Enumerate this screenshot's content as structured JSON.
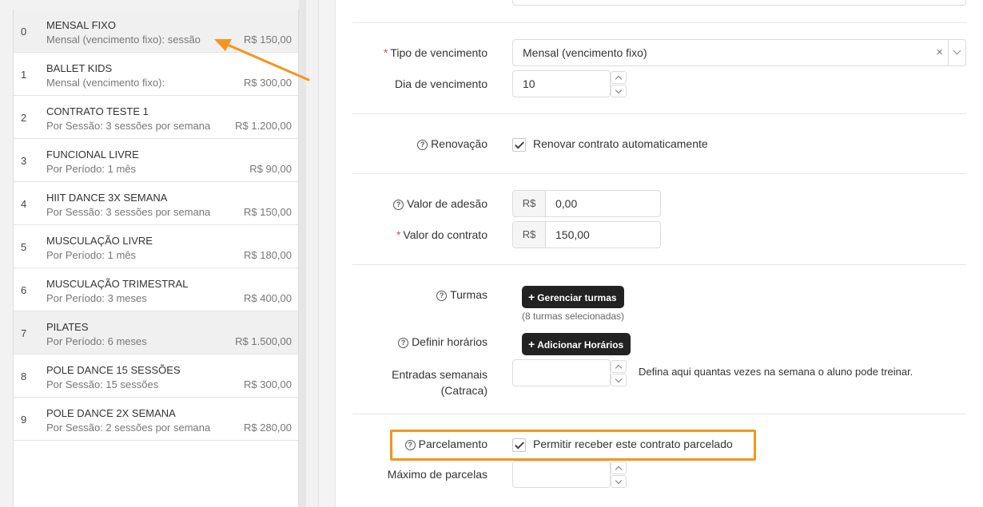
{
  "contracts": [
    {
      "index": "0",
      "name": "MENSAL FIXO",
      "description": "Mensal (vencimento fixo): sessão",
      "price": "R$ 150,00"
    },
    {
      "index": "1",
      "name": "BALLET KIDS",
      "description": "Mensal (vencimento fixo):",
      "price": "R$ 300,00"
    },
    {
      "index": "2",
      "name": "CONTRATO TESTE 1",
      "description": "Por Sessão: 3 sessões por semana",
      "price": "R$ 1.200,00"
    },
    {
      "index": "3",
      "name": "FUNCIONAL LIVRE",
      "description": "Por Período: 1 mês",
      "price": "R$ 90,00"
    },
    {
      "index": "4",
      "name": "HIIT DANCE 3X SEMANA",
      "description": "Por Sessão: 3 sessões por semana",
      "price": "R$ 150,00"
    },
    {
      "index": "5",
      "name": "MUSCULAÇÃO LIVRE",
      "description": "Por Período: 1 mês",
      "price": "R$ 180,00"
    },
    {
      "index": "6",
      "name": "MUSCULAÇÃO TRIMESTRAL",
      "description": "Por Período: 3 meses",
      "price": "R$ 400,00"
    },
    {
      "index": "7",
      "name": "PILATES",
      "description": "Por Período: 6 meses",
      "price": "R$ 1.500,00"
    },
    {
      "index": "8",
      "name": "POLE DANCE 15 SESSÕES",
      "description": "Por Sessão: 15 sessões",
      "price": "R$ 300,00"
    },
    {
      "index": "9",
      "name": "POLE DANCE 2X SEMANA",
      "description": "Por Sessão: 2 sessões por semana",
      "price": "R$ 280,00"
    }
  ],
  "form": {
    "tipo_vencimento": {
      "label": "Tipo de vencimento",
      "required_mark": "*",
      "value": "Mensal (vencimento fixo)",
      "clear": "×"
    },
    "dia_vencimento": {
      "label": "Dia de vencimento",
      "value": "10"
    },
    "renovacao": {
      "label": "Renovação",
      "checkbox_label": "Renovar contrato automaticamente",
      "checked": true
    },
    "valor_adesao": {
      "label": "Valor de adesão",
      "prefix": "R$",
      "value": "0,00"
    },
    "valor_contrato": {
      "label": "Valor do contrato",
      "required_mark": "*",
      "prefix": "R$",
      "value": "150,00"
    },
    "turmas": {
      "label": "Turmas",
      "button": "Gerenciar turmas",
      "note": "(8 turmas selecionadas)"
    },
    "horarios": {
      "label": "Definir horários",
      "button": "Adicionar Horários"
    },
    "entradas": {
      "label_line1": "Entradas semanais",
      "label_line2": "(Catraca)",
      "value": "",
      "help": "Defina aqui quantas vezes na semana o aluno pode treinar."
    },
    "parcelamento": {
      "label": "Parcelamento",
      "checkbox_label": "Permitir receber este contrato parcelado",
      "checked": true
    },
    "max_parcelas": {
      "label": "Máximo de parcelas",
      "value": ""
    }
  },
  "icons": {
    "help": "?",
    "plus": "+"
  },
  "colors": {
    "annotation": "#f7941d",
    "required": "#d9534f",
    "dark_button": "#222222"
  }
}
